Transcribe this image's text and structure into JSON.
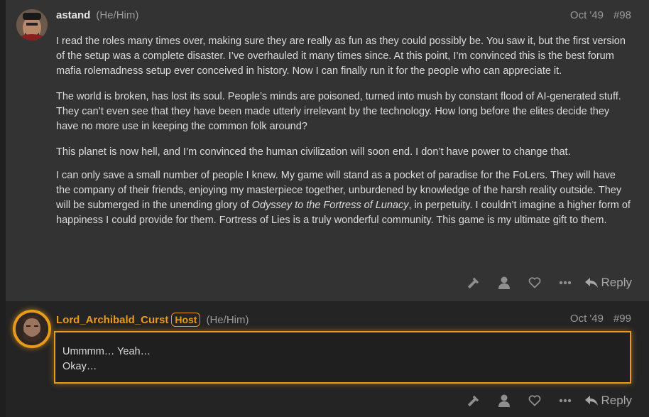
{
  "post1": {
    "username": "astand",
    "pronouns": "(He/Him)",
    "date": "Oct '49",
    "post_number": "#98",
    "paragraphs": [
      "I read the roles many times over, making sure they are really as fun as they could possibly be. You saw it, but the first version of the setup was a complete disaster. I’ve overhauled it many times since. At this point, I’m convinced this is the best forum mafia rolemadness setup ever conceived in history. Now I can finally run it for the people who can appreciate it.",
      "The world is broken, has lost its soul. People’s minds are poisoned, turned into mush by constant flood of AI-generated stuff. They can’t even see that they have been made utterly irrelevant by the technology. How long before the elites decide they have no more use in keeping the common folk around?",
      "This planet is now hell, and I’m convinced the human civilization will soon end. I don’t have power to change that."
    ],
    "p4_before": "I can only save a small number of people I knew. My game will stand as a pocket of paradise for the FoLers. They will have the company of their friends, enjoying my masterpiece together, unburdened by knowledge of the harsh reality outside. They will be submerged in the unending glory of ",
    "p4_italic": "Odyssey to the Fortress of Lunacy",
    "p4_after": ", in perpetuity. I couldn’t imagine a higher form of happiness I could provide for them. Fortress of Lies is a truly wonderful community. This game is my ultimate gift to them.",
    "reply_label": "Reply"
  },
  "post2": {
    "username": "Lord_Archibald_Curst",
    "badge": "Host",
    "pronouns": "(He/Him)",
    "date": "Oct '49",
    "post_number": "#99",
    "line1": "Ummmm… Yeah…",
    "line2": "Okay…",
    "reply_label": "Reply"
  },
  "colors": {
    "accent": "#e89b1a",
    "post_bg": "#333333",
    "page_bg": "#1f1f1f"
  },
  "icons": [
    "gavel-icon",
    "user-icon",
    "heart-icon",
    "more-icon",
    "reply-icon"
  ]
}
